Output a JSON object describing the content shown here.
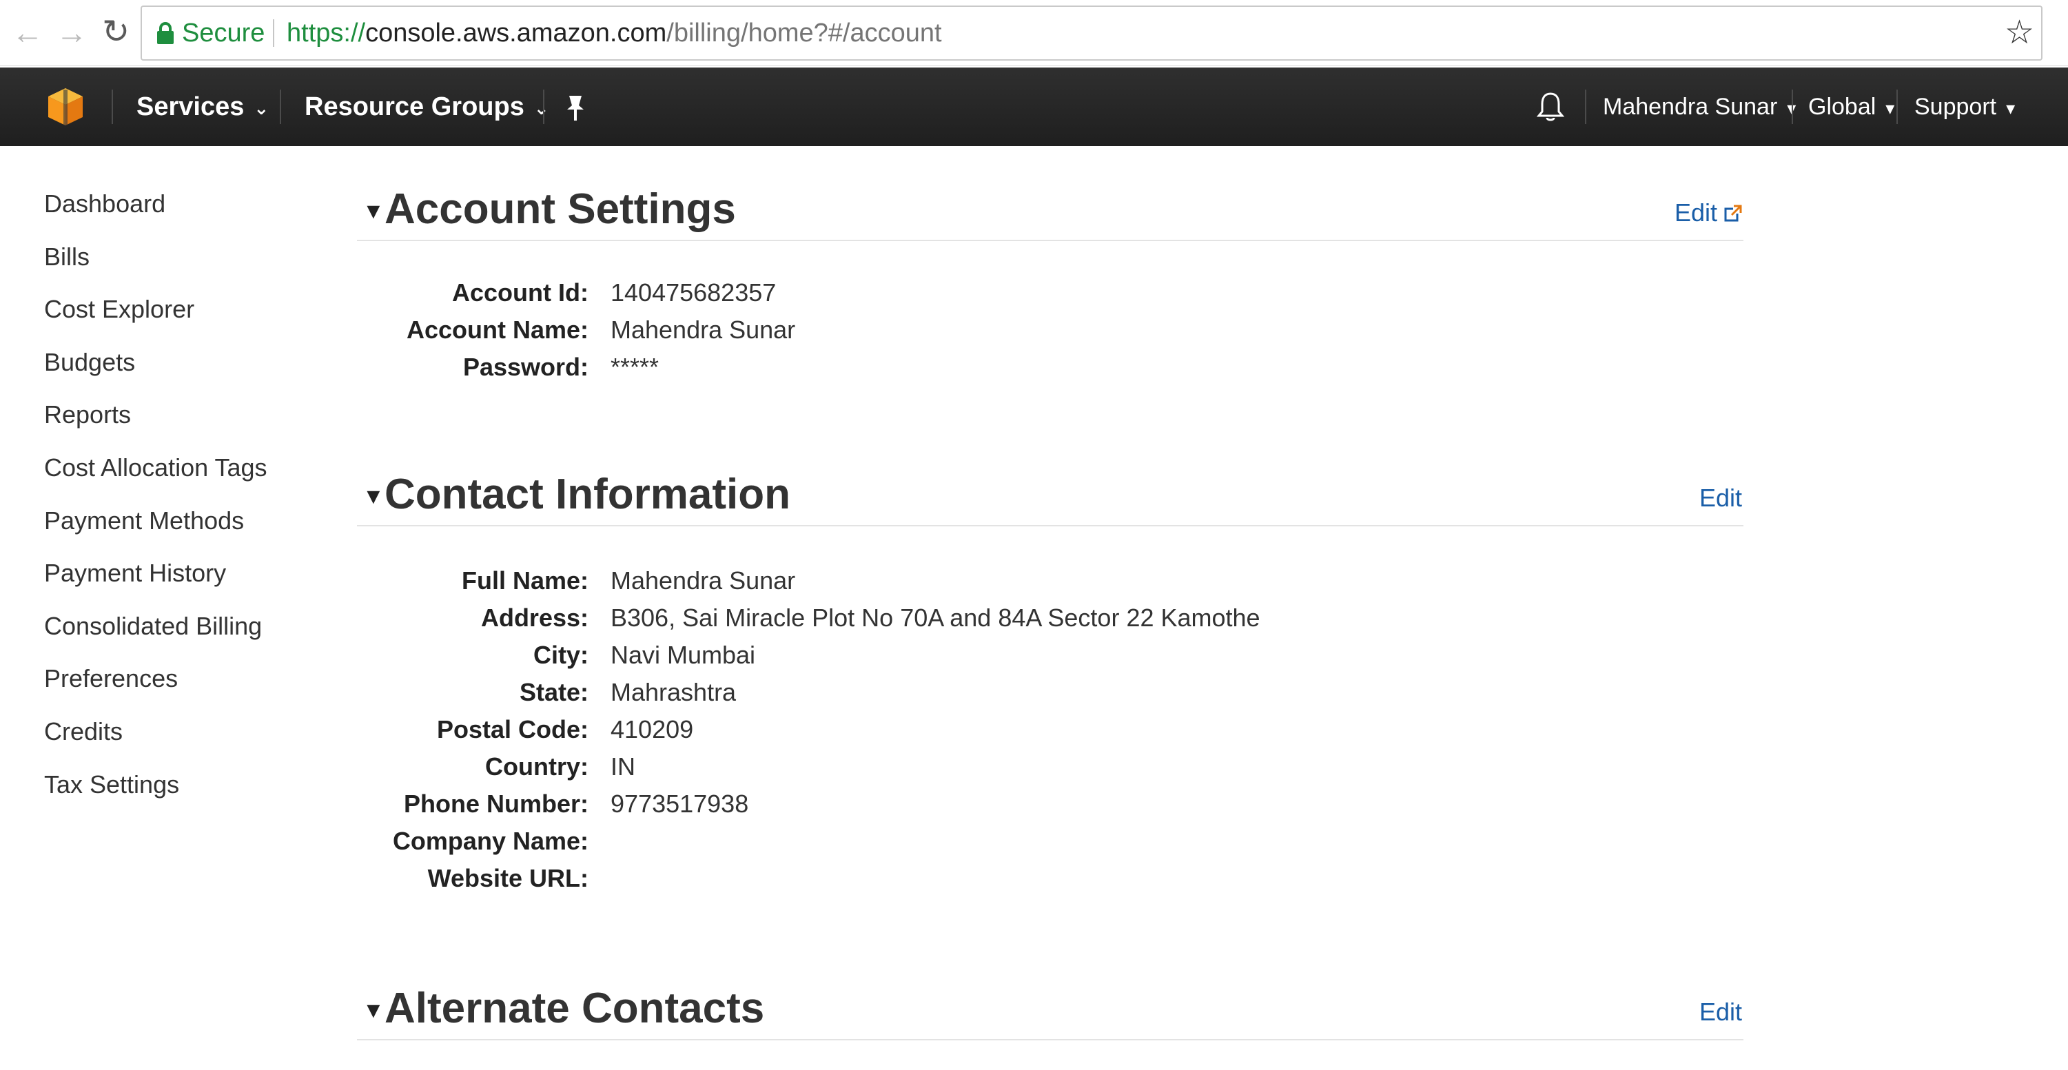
{
  "browser": {
    "secure_label": "Secure",
    "url_scheme": "https://",
    "url_host": "console.aws.amazon.com",
    "url_path": "/billing/home?#/account"
  },
  "topnav": {
    "services": "Services",
    "resource_groups": "Resource Groups",
    "user": "Mahendra Sunar",
    "region": "Global",
    "support": "Support"
  },
  "sidebar": {
    "items": [
      {
        "label": "Dashboard"
      },
      {
        "label": "Bills"
      },
      {
        "label": "Cost Explorer"
      },
      {
        "label": "Budgets"
      },
      {
        "label": "Reports"
      },
      {
        "label": "Cost Allocation Tags"
      },
      {
        "label": "Payment Methods"
      },
      {
        "label": "Payment History"
      },
      {
        "label": "Consolidated Billing"
      },
      {
        "label": "Preferences"
      },
      {
        "label": "Credits"
      },
      {
        "label": "Tax Settings"
      }
    ]
  },
  "account_settings": {
    "title": "Account Settings",
    "edit": "Edit",
    "fields": [
      {
        "label": "Account Id:",
        "value": "140475682357"
      },
      {
        "label": "Account Name:",
        "value": "Mahendra Sunar"
      },
      {
        "label": "Password:",
        "value": "*****"
      }
    ]
  },
  "contact_information": {
    "title": "Contact Information",
    "edit": "Edit",
    "fields": [
      {
        "label": "Full Name:",
        "value": "Mahendra Sunar"
      },
      {
        "label": "Address:",
        "value": "B306, Sai Miracle Plot No 70A and 84A Sector 22 Kamothe"
      },
      {
        "label": "City:",
        "value": "Navi Mumbai"
      },
      {
        "label": "State:",
        "value": "Mahrashtra"
      },
      {
        "label": "Postal Code:",
        "value": "410209"
      },
      {
        "label": "Country:",
        "value": "IN"
      },
      {
        "label": "Phone Number:",
        "value": "9773517938"
      },
      {
        "label": "Company Name:",
        "value": ""
      },
      {
        "label": "Website URL:",
        "value": ""
      }
    ]
  },
  "alternate_contacts": {
    "title": "Alternate Contacts",
    "edit": "Edit"
  },
  "icons": {
    "back": "back-arrow-icon",
    "forward": "forward-arrow-icon",
    "reload": "reload-icon",
    "lock": "lock-icon",
    "star": "bookmark-star-icon",
    "logo": "aws-cube-logo-icon",
    "pin": "pin-icon",
    "bell": "bell-icon",
    "external": "external-link-icon"
  },
  "colors": {
    "nav_bg": "#232f3e",
    "link": "#1a5ea8",
    "secure": "#1e8e3e",
    "logo_orange": "#f7981d"
  }
}
